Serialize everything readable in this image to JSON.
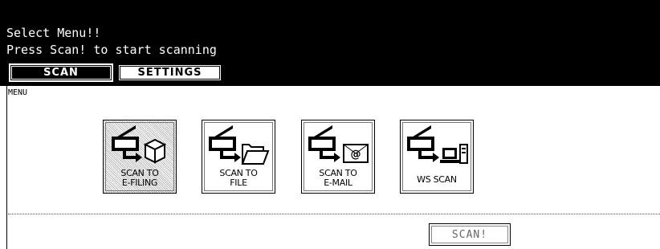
{
  "header": {
    "line1": "Select Menu!!",
    "line2": "Press Scan! to start scanning"
  },
  "tabs": [
    {
      "label": "SCAN",
      "active": true
    },
    {
      "label": "SETTINGS",
      "active": false
    }
  ],
  "menu_label": "MENU",
  "functions": [
    {
      "label": "SCAN TO\nE-FILING",
      "icon": "scan-to-efiling-icon",
      "selected": true
    },
    {
      "label": "SCAN TO\nFILE",
      "icon": "scan-to-file-icon",
      "selected": false
    },
    {
      "label": "SCAN TO\nE-MAIL",
      "icon": "scan-to-email-icon",
      "selected": false
    },
    {
      "label": "WS SCAN",
      "icon": "ws-scan-icon",
      "selected": false
    }
  ],
  "scan_button": {
    "label": "SCAN!",
    "enabled": false
  }
}
